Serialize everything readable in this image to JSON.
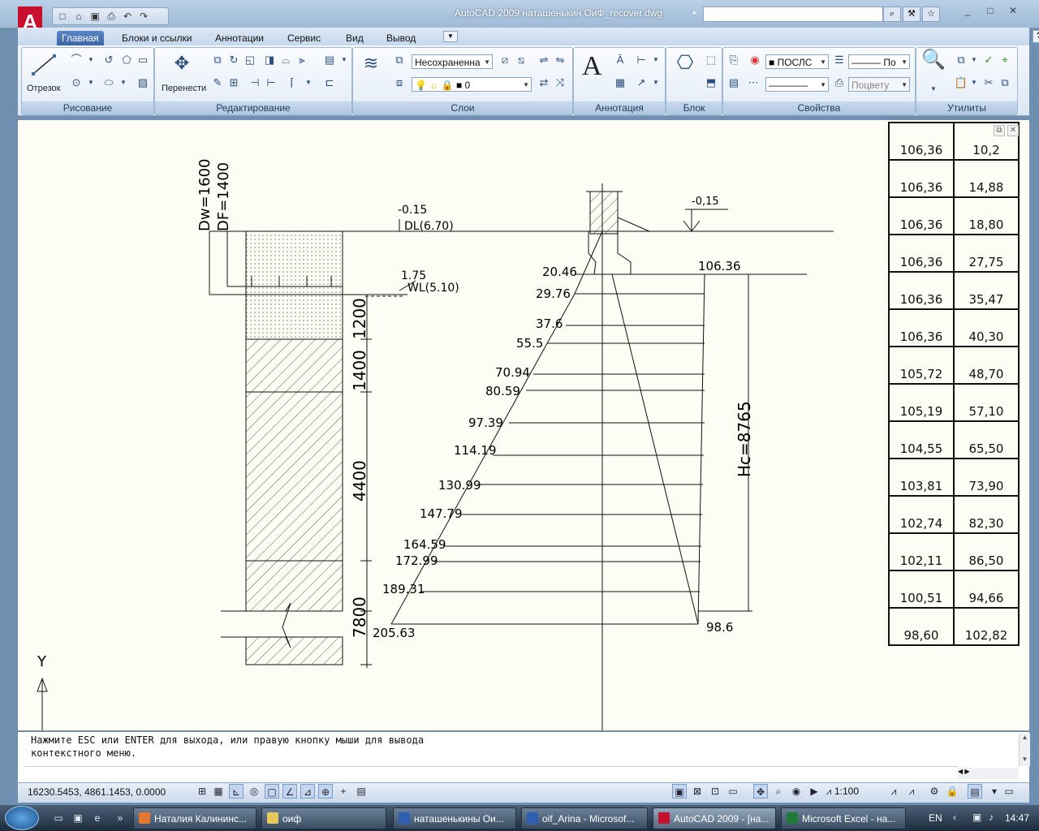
{
  "window": {
    "title": "AutoCAD 2009 наташенькин ОиФ_recover.dwg",
    "logo_letter": "A",
    "controls": [
      "_",
      "□",
      "✕"
    ]
  },
  "quick_access": [
    "□",
    "⌂",
    "▣",
    "⎙",
    "↶",
    "↷"
  ],
  "title_tools": [
    "⌕",
    "⚒",
    "☆"
  ],
  "ribbon": {
    "tabs": [
      "Главная",
      "Блоки и ссылки",
      "Аннотации",
      "Сервис",
      "Вид",
      "Вывод"
    ],
    "active_tab": "Главная",
    "panels": {
      "draw": {
        "title": "Рисование",
        "line_label": "Отрезок"
      },
      "modify": {
        "title": "Редактирование",
        "move_label": "Перенести"
      },
      "layers": {
        "title": "Слои",
        "state_value": "Несохраненна",
        "layer_value": "0"
      },
      "annotation": {
        "title": "Аннотация",
        "text_icon": "A"
      },
      "block": {
        "title": "Блок"
      },
      "properties": {
        "title": "Свойства",
        "color_value": "ПОСЛС",
        "linetype_value": "По",
        "plotstyle_value": "Поцвету"
      },
      "utilities": {
        "title": "Утилиты"
      }
    }
  },
  "drawing": {
    "left_labels": {
      "dw": "Dw=1600",
      "df": "DF=1400"
    },
    "level_top": "-0.15",
    "dl": "DL(6.70)",
    "level_wl": "1.75",
    "wl": "WL(5.10)",
    "layer_dims": [
      "1200",
      "1400",
      "4400",
      "7800"
    ],
    "right_level": "-0,15",
    "hc": "Hc=8765",
    "right_top_value": "106.36",
    "right_bottom_value": "98.6",
    "axis_label": "Y",
    "left_values": [
      "20.46",
      "29.76",
      "37.6",
      "55.5",
      "70.94",
      "80.59",
      "97.39",
      "114.19",
      "130.99",
      "147.79",
      "164.59",
      "172.99",
      "189.31",
      "205.63"
    ]
  },
  "table": {
    "rows": [
      [
        "106,36",
        "10,2"
      ],
      [
        "106,36",
        "14,88"
      ],
      [
        "106,36",
        "18,80"
      ],
      [
        "106,36",
        "27,75"
      ],
      [
        "106,36",
        "35,47"
      ],
      [
        "106,36",
        "40,30"
      ],
      [
        "105,72",
        "48,70"
      ],
      [
        "105,19",
        "57,10"
      ],
      [
        "104,55",
        "65,50"
      ],
      [
        "103,81",
        "73,90"
      ],
      [
        "102,74",
        "82,30"
      ],
      [
        "102,11",
        "86,50"
      ],
      [
        "100,51",
        "94,66"
      ],
      [
        "98,60",
        "102,82"
      ]
    ]
  },
  "command_line": {
    "line1": "Нажмите ESC или ENTER для выхода, или правую кнопку мыши для вывода",
    "line2": "контекстного меню."
  },
  "status_bar": {
    "coords": "16230.5453, 4861.1453, 0.0000",
    "scale": "1:100"
  },
  "taskbar": {
    "items": [
      {
        "label": "Наталия Калининс...",
        "color": "#e6772e",
        "active": false
      },
      {
        "label": "оиф",
        "color": "#e8c85a",
        "active": false
      },
      {
        "label": "наташенькины Ои...",
        "color": "#2f5fb3",
        "active": false
      },
      {
        "label": "oif_Arina - Microsof...",
        "color": "#2f5fb3",
        "active": false
      },
      {
        "label": "AutoCAD 2009 - [на...",
        "color": "#c8102e",
        "active": true
      },
      {
        "label": "Microsoft Excel - на...",
        "color": "#1e7a3a",
        "active": false
      }
    ],
    "language": "EN",
    "clock": "14:47"
  }
}
